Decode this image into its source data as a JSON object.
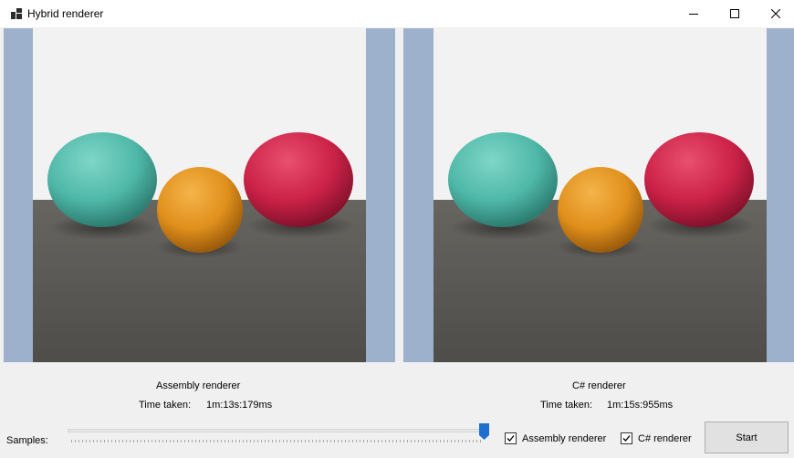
{
  "window": {
    "title": "Hybrid renderer",
    "icon": "app-window-icon",
    "controls": [
      "minimize-icon",
      "maximize-icon",
      "close-icon"
    ]
  },
  "panels": [
    {
      "name": "Assembly renderer",
      "time_label": "Time taken:",
      "time_value": "1m:13s:179ms"
    },
    {
      "name": "C# renderer",
      "time_label": "Time taken:",
      "time_value": "1m:15s:955ms"
    }
  ],
  "controls": {
    "samples_label": "Samples:",
    "samples_slider_level": 1.0,
    "checkboxes": [
      {
        "label": "Assembly renderer",
        "checked": true
      },
      {
        "label": "C# renderer",
        "checked": true
      }
    ],
    "start_label": "Start"
  },
  "colors": {
    "viewport_background": "#9db0cc",
    "sphere_teal": "#4fb8a8",
    "sphere_orange": "#e0901c",
    "sphere_red": "#cc2248",
    "floor": "#5b5955",
    "slider_thumb": "#1e6fd0"
  }
}
